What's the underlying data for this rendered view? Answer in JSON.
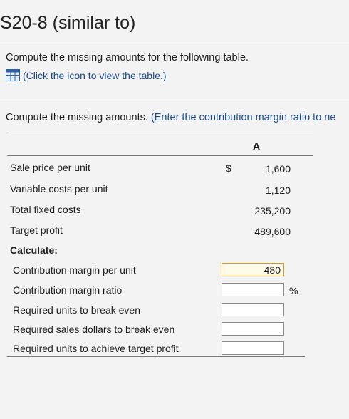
{
  "page_title": "S20-8 (similar to)",
  "instruction": "Compute the missing amounts for the following table.",
  "table_link": "(Click the icon to view the table.)",
  "compute_text": "Compute the missing amounts.",
  "compute_note": "(Enter the contribution margin ratio to ne",
  "column_header": "A",
  "currency_symbol": "$",
  "given_rows": [
    {
      "label": "Sale price per unit",
      "value": "1,600"
    },
    {
      "label": "Variable costs per unit",
      "value": "1,120"
    },
    {
      "label": "Total fixed costs",
      "value": "235,200"
    },
    {
      "label": "Target profit",
      "value": "489,600"
    }
  ],
  "calculate_label": "Calculate:",
  "calc_rows": [
    {
      "label": "Contribution margin per unit",
      "value": "480"
    },
    {
      "label": "Contribution margin ratio",
      "value": ""
    },
    {
      "label": "Required units to break even",
      "value": ""
    },
    {
      "label": "Required sales dollars to break even",
      "value": ""
    },
    {
      "label": "Required units to achieve target profit",
      "value": ""
    }
  ],
  "percent_symbol": "%",
  "colors": {
    "link_blue": "#1a4a8c",
    "highlight_border": "#d89a2c"
  }
}
